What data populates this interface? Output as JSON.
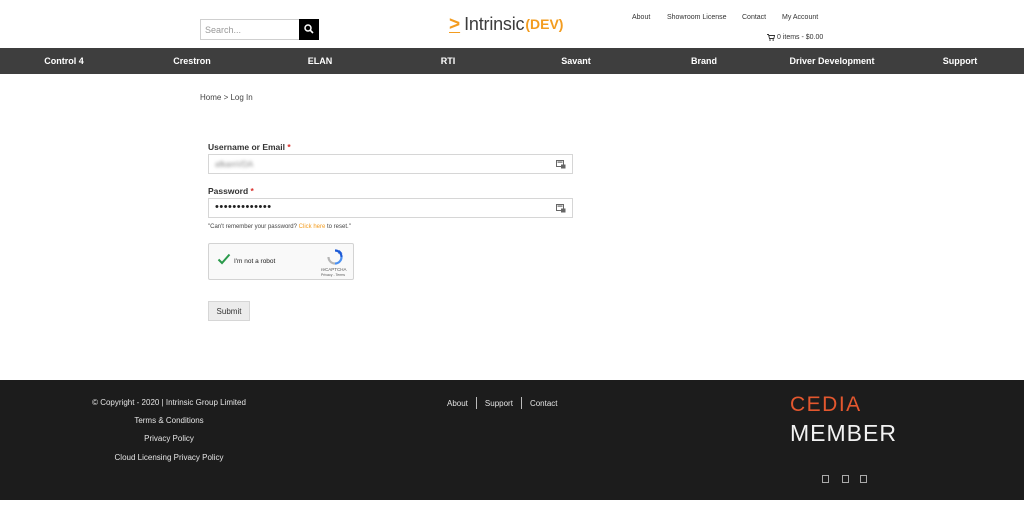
{
  "header": {
    "search_placeholder": "Search...",
    "logo": {
      "caret": ">",
      "name": "Intrinsic",
      "suffix": "(DEV)"
    },
    "top_links": [
      "About",
      "Showroom License",
      "Contact",
      "My Account"
    ],
    "cart": "0 items - $0.00"
  },
  "nav": {
    "items": [
      "Control 4",
      "Crestron",
      "ELAN",
      "RTI",
      "Savant",
      "Brand",
      "Driver Development",
      "Support"
    ]
  },
  "breadcrumb": "Home > Log In",
  "form": {
    "username_label": "Username or Email",
    "required_mark": "*",
    "username_value": "afkamVDA",
    "password_label": "Password",
    "password_value": "•••••••••••••",
    "hint_prefix": "\"Can't remember your password? ",
    "hint_link": "Click here",
    "hint_suffix": " to reset.\"",
    "captcha_label": "I'm not a robot",
    "captcha_brand": "reCAPTCHA",
    "captcha_terms": "Privacy - Terms",
    "submit_label": "Submit"
  },
  "footer": {
    "copyright": "© Copyright - 2020 | Intrinsic Group Limited",
    "terms": "Terms & Conditions",
    "privacy": "Privacy Policy",
    "cloud_privacy": "Cloud Licensing Privacy Policy",
    "links": [
      "About",
      "Support",
      "Contact"
    ],
    "badge_top": "CEDIA",
    "badge_bottom": "MEMBER"
  },
  "colors": {
    "accent": "#f39c1f",
    "nav_bg": "#3e3e3e",
    "footer_bg": "#1c1c1c",
    "cedia_orange": "#e4572e",
    "required": "#d9302c"
  }
}
